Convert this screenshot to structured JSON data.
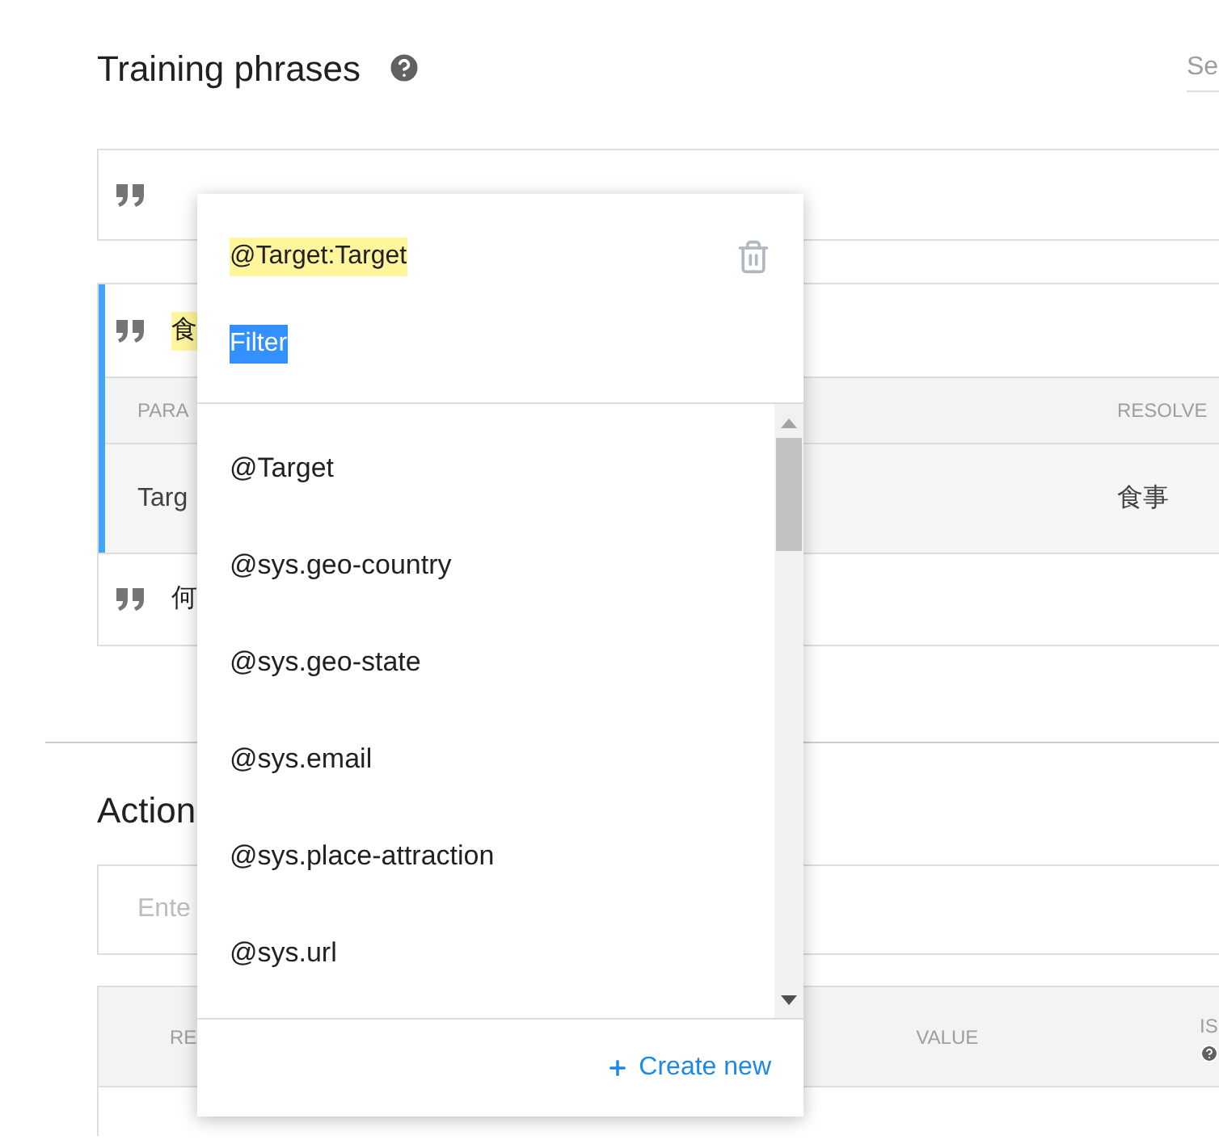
{
  "training_phrases": {
    "title": "Training phrases",
    "search": {
      "placeholder": "Se"
    },
    "phrases": [
      {
        "text": "食",
        "highlighted": true,
        "selected": true,
        "table": {
          "columns": [
            "PARA",
            "RESOLVE"
          ],
          "rows": [
            [
              "Targ",
              "食事"
            ]
          ]
        }
      },
      {
        "text": "何",
        "highlighted": false,
        "selected": false
      }
    ]
  },
  "actions": {
    "title": "Action",
    "field": {
      "placeholder": "Ente"
    },
    "table": {
      "columns": [
        "RE",
        "VALUE",
        "IS"
      ]
    }
  },
  "popup": {
    "annotation": "@Target:Target",
    "filter": {
      "value": "Filter",
      "text_selected": true
    },
    "items": [
      "@Target",
      "@sys.geo-country",
      "@sys.geo-state",
      "@sys.email",
      "@sys.place-attraction",
      "@sys.url"
    ],
    "create_button": "Create new"
  }
}
